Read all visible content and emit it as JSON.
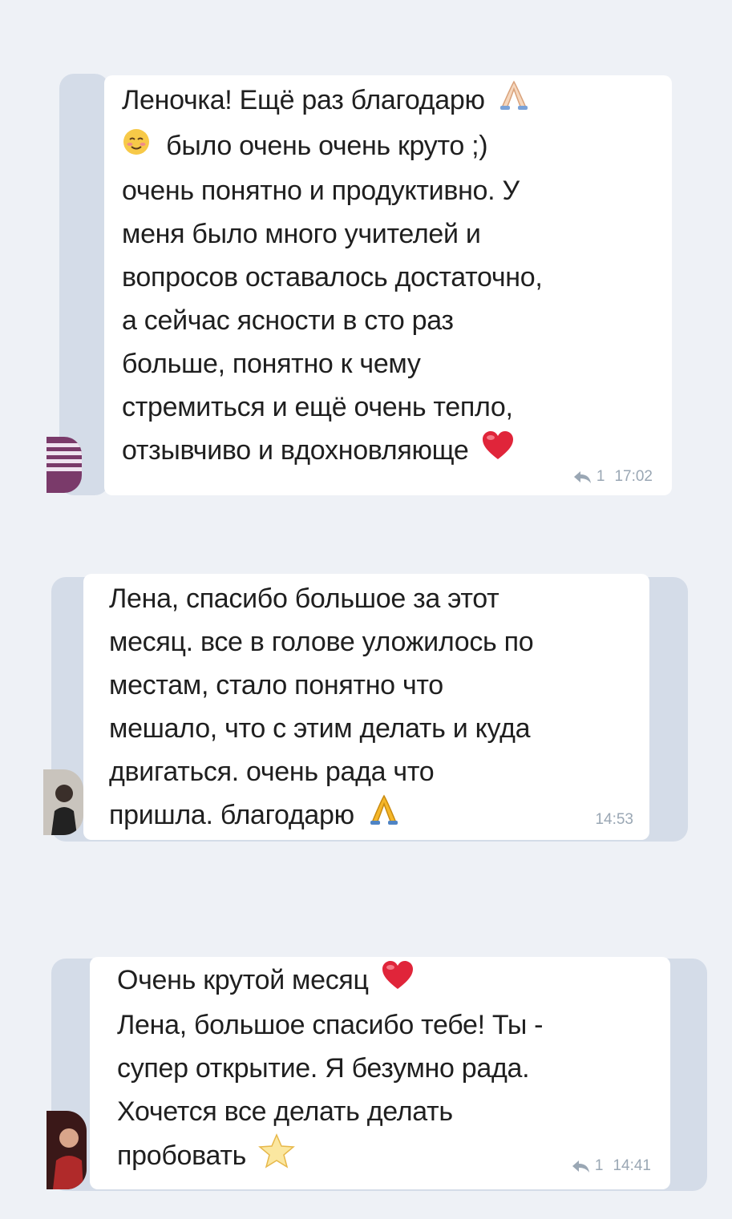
{
  "messages": [
    {
      "lines": [
        "Леночка! Ещё раз благодарю",
        "было очень очень круто ;)",
        "очень понятно и продуктивно. У",
        "меня было много учителей и",
        "вопросов оставалось достаточно,",
        "а сейчас ясности в сто раз",
        "больше, понятно к чему",
        "стремиться  и ещё очень тепло,",
        "отзывчиво и вдохновляюще"
      ],
      "reply_count": "1",
      "time": "17:02"
    },
    {
      "lines": [
        "Лена, спасибо большое за этот",
        "месяц. все в голове уложилось по",
        "местам, стало понятно что",
        "мешало, что с этим делать и куда",
        "двигаться. очень рада что",
        "пришла. благодарю"
      ],
      "time": "14:53"
    },
    {
      "lines": [
        "Очень крутой месяц",
        "Лена, большое спасибо тебе! Ты -",
        "супер открытие. Я безумно рада.",
        "Хочется все делать делать",
        "пробовать"
      ],
      "reply_count": "1",
      "time": "14:41"
    }
  ],
  "icons": {
    "pray": "pray-emoji",
    "smile": "smiling-face-emoji",
    "heart": "red-heart-emoji",
    "star": "star-emoji",
    "reply": "reply-arrow-icon"
  },
  "colors": {
    "background": "#eef1f6",
    "bubble": "#ffffff",
    "meta": "#9aa7b4",
    "heart": "#e0253a"
  }
}
